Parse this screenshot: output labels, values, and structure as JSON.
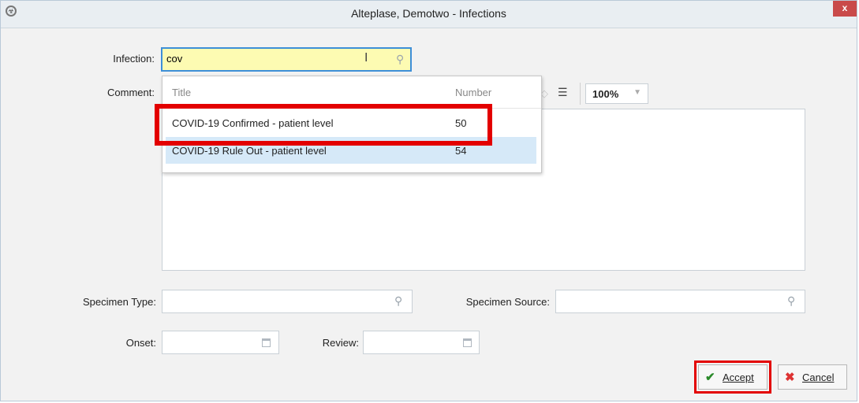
{
  "window": {
    "title": "Alteplase, Demotwo - Infections",
    "close_label": "x",
    "title_icon": "biohazard-icon"
  },
  "infection": {
    "label": "Infection:",
    "value": "cov"
  },
  "comment": {
    "label": "Comment:",
    "zoom": "100%"
  },
  "dropdown": {
    "columns": [
      "Title",
      "Number"
    ],
    "rows": [
      {
        "title": "COVID-19 Confirmed - patient level",
        "number": "50"
      },
      {
        "title": "COVID-19 Rule Out - patient level",
        "number": "54"
      }
    ]
  },
  "specimen": {
    "type_label": "Specimen Type:",
    "source_label": "Specimen Source:"
  },
  "dates": {
    "onset_label": "Onset:",
    "review_label": "Review:"
  },
  "buttons": {
    "accept": "Accept",
    "cancel": "Cancel"
  },
  "colors": {
    "highlight": "#e30000",
    "input_focus": "#3d8fd8",
    "selected_row": "#d6e9f8"
  }
}
